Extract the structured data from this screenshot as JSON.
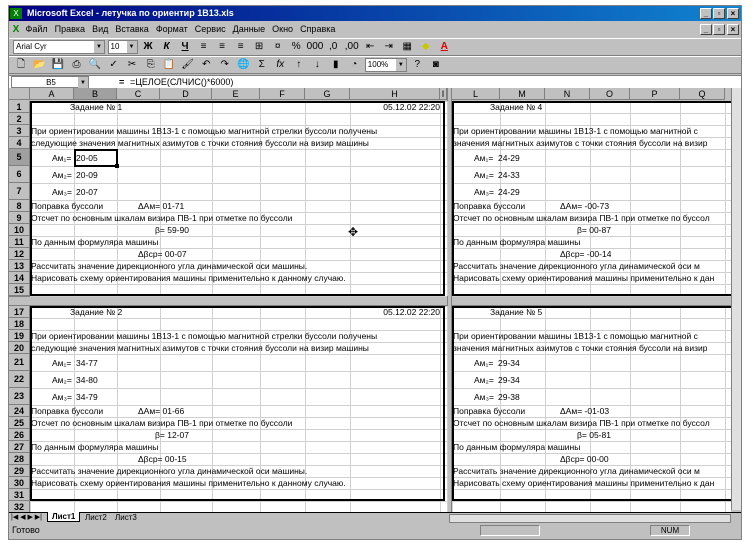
{
  "window": {
    "title": "Microsoft Excel - летучка по ориентир 1В13.xls"
  },
  "menu": [
    "Файл",
    "Правка",
    "Вид",
    "Вставка",
    "Формат",
    "Сервис",
    "Данные",
    "Окно",
    "Справка"
  ],
  "format_toolbar": {
    "font": "Arial Cyr",
    "size": "10",
    "bold": "Ж",
    "italic": "К",
    "underline": "Ч"
  },
  "standard_toolbar": {
    "zoom": "100%"
  },
  "formula_bar": {
    "cell_ref": "B5",
    "equals": "=",
    "formula": "=ЦЕЛОЕ(СЛЧИС()*6000)"
  },
  "columns_left": [
    "A",
    "B",
    "C",
    "D",
    "E",
    "F",
    "G",
    "H",
    "I"
  ],
  "columns_right": [
    "L",
    "M",
    "N",
    "O",
    "P",
    "Q"
  ],
  "rows": [
    1,
    2,
    3,
    4,
    5,
    6,
    7,
    8,
    9,
    10,
    11,
    12,
    13,
    14,
    15,
    17,
    18,
    19,
    20,
    21,
    22,
    23,
    24,
    25,
    26,
    27,
    28,
    29,
    30,
    31,
    32
  ],
  "blocks": [
    {
      "title": "Задание № 1",
      "date": "05.12.02 22:20",
      "line1": "При   ориентировании   машины   1В13-1   с   помощью   магнитной   стрелки   буссоли   получены",
      "line2": "следующие значения магнитных азимутов с точки стояния буссоли на визир машины",
      "am1_label": "Ам₁=",
      "am1": "20-05",
      "am2_label": "Ам₂=",
      "am2": "20-09",
      "am3_label": "Ам₃=",
      "am3": "20-07",
      "corr_label": "Поправка буссоли",
      "dam": "ΔАм= 01-71",
      "line3": "Отсчет по основным шкалам визира ПВ-1 при отметке по буссоли",
      "beta": "β= 59-90",
      "line4": "По данным формуляра машины",
      "dbeta": "Δβср= 00-07",
      "line5": "Рассчитать значение дирекционного угла  динамической оси машины.",
      "line6": "Нарисовать схему ориентирования машины применительно к данному случаю."
    },
    {
      "title": "Задание № 2",
      "date": "05.12.02 22:20",
      "line1": "При   ориентировании   машины   1В13-1   с   помощью   магнитной   стрелки   буссоли   получены",
      "line2": "следующие значения магнитных азимутов с точки стояния буссоли на визир машины",
      "am1_label": "Ам₁=",
      "am1": "34-77",
      "am2_label": "Ам₂=",
      "am2": "34-80",
      "am3_label": "Ам₃=",
      "am3": "34-79",
      "corr_label": "Поправка буссоли",
      "dam": "ΔАм= 01-66",
      "line3": "Отсчет по основным шкалам визира ПВ-1 при отметке по буссоли",
      "beta": "β= 12-07",
      "line4": "По данным формуляра машины",
      "dbeta": "Δβср= 00-15",
      "line5": "Рассчитать значение дирекционного угла  динамической оси машины.",
      "line6": "Нарисовать схему ориентирования машины применительно к данному случаю."
    },
    {
      "title": "Задание № 4",
      "line1": "При  ориентировании  машины  1В13-1  с  помощью  магнитной  с",
      "line2": "значения магнитных азимутов с точки стояния буссоли на визир",
      "am1_label": "Ам₁=",
      "am1": "24-29",
      "am2_label": "Ам₂=",
      "am2": "24-33",
      "am3_label": "Ам₃=",
      "am3": "24-29",
      "corr_label": "Поправка буссоли",
      "dam": "ΔАм= -00-73",
      "line3": "Отсчет по основным шкалам визира ПВ-1 при отметке по буссол",
      "beta": "β= 00-87",
      "line4": "По данным формуляра машины",
      "dbeta": "Δβср= -00-14",
      "line5": "Рассчитать значение дирекционного угла  динамической оси м",
      "line6": "Нарисовать схему ориентирования машины применительно к дан"
    },
    {
      "title": "Задание № 5",
      "line1": "При  ориентировании  машины  1В13-1  с  помощью  магнитной  с",
      "line2": "значения магнитных азимутов с точки стояния буссоли на визир",
      "am1_label": "Ам₁=",
      "am1": "29-34",
      "am2_label": "Ам₂=",
      "am2": "29-34",
      "am3_label": "Ам₃=",
      "am3": "29-38",
      "corr_label": "Поправка буссоли",
      "dam": "ΔАм= -01-03",
      "line3": "Отсчет по основным шкалам визира ПВ-1 при отметке по буссол",
      "beta": "β= 05-81",
      "line4": "По данным формуляра машины",
      "dbeta": "Δβср= 00-00",
      "line5": "Рассчитать значение дирекционного угла  динамической оси м",
      "line6": "Нарисовать схему ориентирования машины применительно к дан"
    }
  ],
  "sheet_tabs": [
    "Лист1",
    "Лист2",
    "Лист3"
  ],
  "status": {
    "text": "Готово",
    "num": "NUM"
  }
}
